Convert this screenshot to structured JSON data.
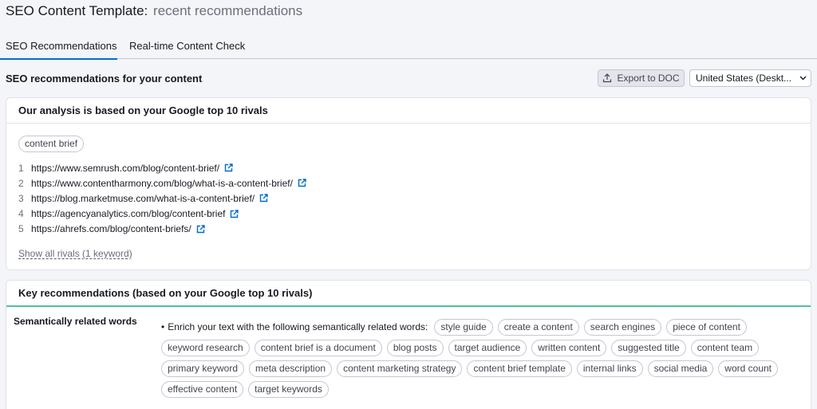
{
  "header": {
    "title": "SEO Content Template:",
    "subtitle": "recent recommendations"
  },
  "tabs": [
    {
      "label": "SEO Recommendations",
      "active": true
    },
    {
      "label": "Real-time Content Check",
      "active": false
    }
  ],
  "toolbar": {
    "section_title": "SEO recommendations for your content",
    "export_label": "Export to DOC",
    "country_value": "United States (Deskt..."
  },
  "rivals_card": {
    "title": "Our analysis is based on your Google top 10 rivals",
    "keyword": "content brief",
    "rivals": [
      {
        "num": "1",
        "url": "https://www.semrush.com/blog/content-brief/"
      },
      {
        "num": "2",
        "url": "https://www.contentharmony.com/blog/what-is-a-content-brief/"
      },
      {
        "num": "3",
        "url": "https://blog.marketmuse.com/what-is-a-content-brief/"
      },
      {
        "num": "4",
        "url": "https://agencyanalytics.com/blog/content-brief"
      },
      {
        "num": "5",
        "url": "https://ahrefs.com/blog/content-briefs/"
      }
    ],
    "show_all_label": "Show all rivals (1 keyword)"
  },
  "recommendations_card": {
    "title": "Key recommendations (based on your Google top 10 rivals)",
    "semantic_label": "Semantically related words",
    "semantic_intro": "Enrich your text with the following semantically related words:",
    "words": [
      "style guide",
      "create a content",
      "search engines",
      "piece of content",
      "keyword research",
      "content brief is a document",
      "blog posts",
      "target audience",
      "written content",
      "suggested title",
      "content team",
      "primary keyword",
      "meta description",
      "content marketing strategy",
      "content brief template",
      "internal links",
      "social media",
      "word count",
      "effective content",
      "target keywords"
    ]
  },
  "colors": {
    "accent_blue": "#006dca",
    "link_icon_blue": "#006dca",
    "green_divider": "#4bc496"
  },
  "icons": {
    "export": "upload-icon",
    "dropdown": "chevron-down-icon",
    "external_link": "external-link-icon"
  }
}
